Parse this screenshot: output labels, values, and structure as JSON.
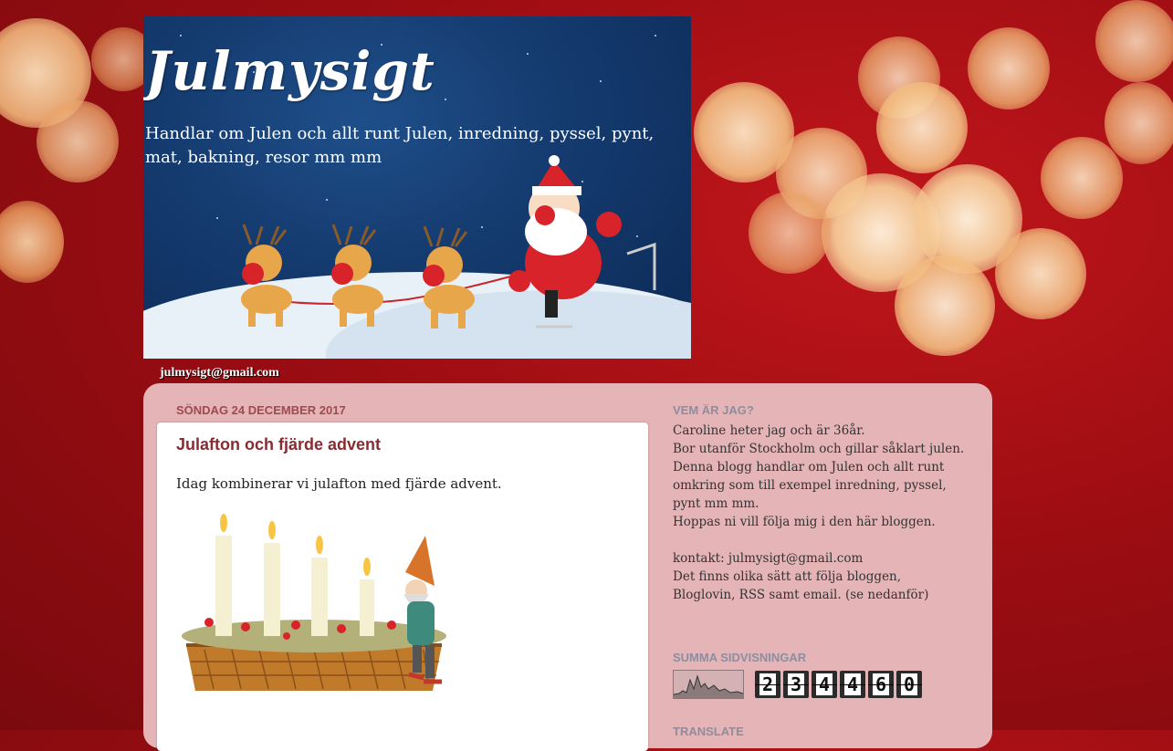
{
  "header": {
    "title": "Julmysigt",
    "description": "Handlar om Julen och allt runt Julen, inredning, pyssel, pynt, mat, bakning, resor mm mm",
    "email": "julmysigt@gmail.com"
  },
  "post": {
    "date": "söndag 24 december 2017",
    "title": "Julafton och fjärde advent",
    "body": "Idag kombinerar vi julafton med fjärde advent."
  },
  "sidebar": {
    "about": {
      "title": "Vem är jag?",
      "lines": [
        "Caroline heter jag och är 36år.",
        "Bor utanför Stockholm och gillar såklart julen.",
        "Denna blogg handlar om Julen och allt runt omkring som till exempel inredning, pyssel, pynt mm mm.",
        "Hoppas ni vill följa mig i den här bloggen.",
        "",
        "kontakt: julmysigt@gmail.com",
        "Det finns olika sätt att följa bloggen, Bloglovin, RSS samt email. (se nedanför)"
      ]
    },
    "stats": {
      "title": "Summa sidvisningar",
      "digits": [
        "2",
        "3",
        "4",
        "4",
        "6",
        "0"
      ]
    },
    "translate": {
      "title": "Translate"
    }
  },
  "colors": {
    "background": "#9d0d12",
    "content_box": "#e5b4b7",
    "post_title": "#8a2b31",
    "date_header": "#9f4a4f",
    "widget_title": "#8c8ea0"
  }
}
